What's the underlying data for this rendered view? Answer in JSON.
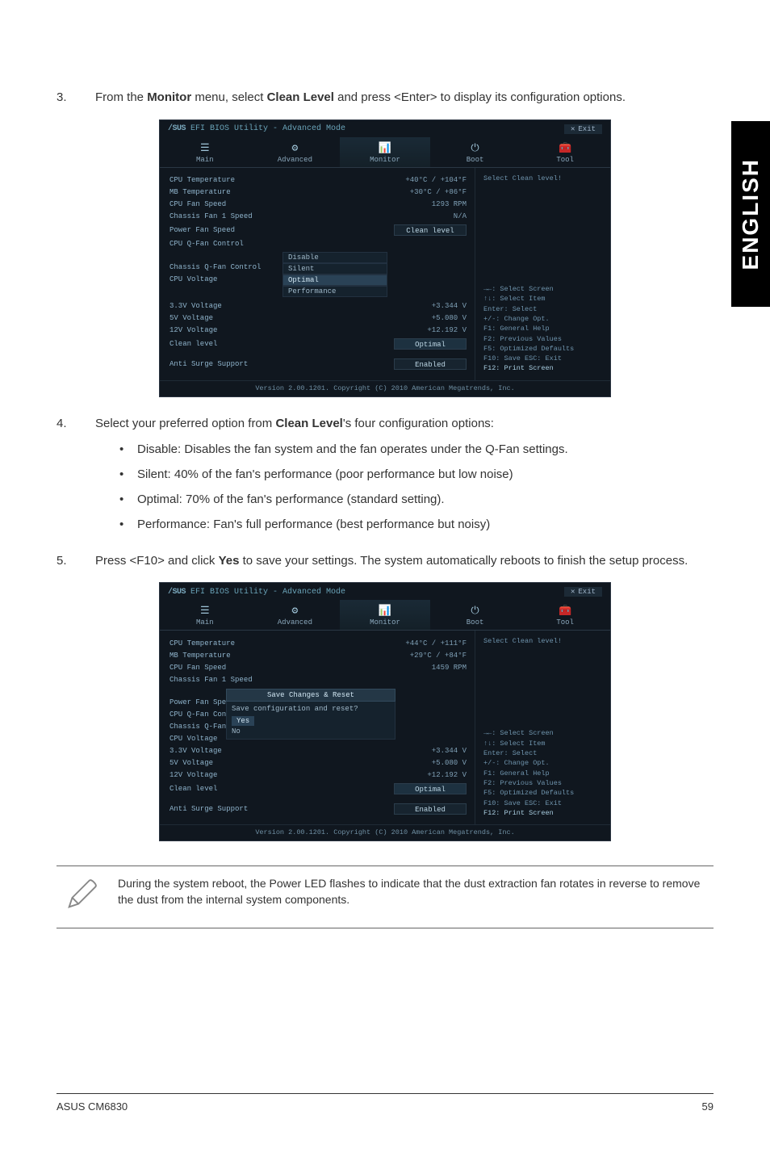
{
  "sidetab": "ENGLISH",
  "step3": {
    "num": "3.",
    "text_a": "From the ",
    "text_b": "Monitor",
    "text_c": " menu, select ",
    "text_d": "Clean Level",
    "text_e": " and press <Enter> to display its configuration options."
  },
  "bios1": {
    "title_logo": "/SUS",
    "title_rest": " EFI BIOS Utility - Advanced Mode",
    "exit": "Exit",
    "tabs": {
      "main": "Main",
      "advanced": "Advanced",
      "monitor": "Monitor",
      "boot": "Boot",
      "tool": "Tool"
    },
    "rows": {
      "cpu_temp_l": "CPU Temperature",
      "cpu_temp_v": "+40°C / +104°F",
      "mb_temp_l": "MB Temperature",
      "mb_temp_v": "+30°C / +86°F",
      "cpu_fan_l": "CPU Fan Speed",
      "cpu_fan_v": "1293 RPM",
      "ch1_l": "Chassis Fan 1 Speed",
      "ch1_v": "N/A",
      "pwr_l": "Power Fan Speed",
      "pwr_v": "Clean level",
      "qfan_l": "CPU Q-Fan Control",
      "chq_l": "Chassis Q-Fan Control",
      "cpuv_l": "CPU Voltage",
      "v33_l": "3.3V Voltage",
      "v33_v": "+3.344 V",
      "v5_l": "5V Voltage",
      "v5_v": "+5.080 V",
      "v12_l": "12V Voltage",
      "v12_v": "+12.192 V",
      "clean_l": "Clean level",
      "clean_v": "Optimal",
      "anti_l": "Anti Surge Support",
      "anti_v": "Enabled"
    },
    "dd": {
      "disable": "Disable",
      "silent": "Silent",
      "optimal": "Optimal",
      "performance": "Performance"
    },
    "right": {
      "help": "Select Clean level!",
      "h1": "→←: Select Screen",
      "h2": "↑↓: Select Item",
      "h3": "Enter: Select",
      "h4": "+/-: Change Opt.",
      "h5": "F1: General Help",
      "h6": "F2: Previous Values",
      "h7": "F5: Optimized Defaults",
      "h8": "F10: Save  ESC: Exit",
      "h9": "F12: Print Screen"
    },
    "version": "Version 2.00.1201. Copyright (C) 2010 American Megatrends, Inc."
  },
  "step4": {
    "num": "4.",
    "text_a": "Select your preferred option from ",
    "text_b": "Clean Level",
    "text_c": "'s four configuration options:",
    "b1": "Disable: Disables the fan system and the fan operates under the Q-Fan settings.",
    "b2": "Silent: 40% of the fan's performance (poor performance but low noise)",
    "b3": "Optimal: 70% of the fan's performance (standard setting).",
    "b4": "Performance: Fan's full performance (best performance but noisy)"
  },
  "step5": {
    "num": "5.",
    "text_a": "Press <F10> and click ",
    "text_b": "Yes",
    "text_c": " to save your settings. The system automatically reboots to finish the setup process."
  },
  "bios2": {
    "rows": {
      "cpu_temp_v": "+44°C / +111°F",
      "mb_temp_v": "+29°C / +84°F",
      "cpu_fan_v": "1459 RPM"
    },
    "dlg_title": "Save Changes & Reset",
    "dlg_body": "Save configuration and reset?",
    "dlg_yes": "Yes",
    "dlg_no": "No"
  },
  "note": "During the system reboot, the Power LED flashes to indicate that the dust extraction fan rotates in reverse to remove the dust from the internal system components.",
  "footer_left": "ASUS CM6830",
  "footer_right": "59"
}
